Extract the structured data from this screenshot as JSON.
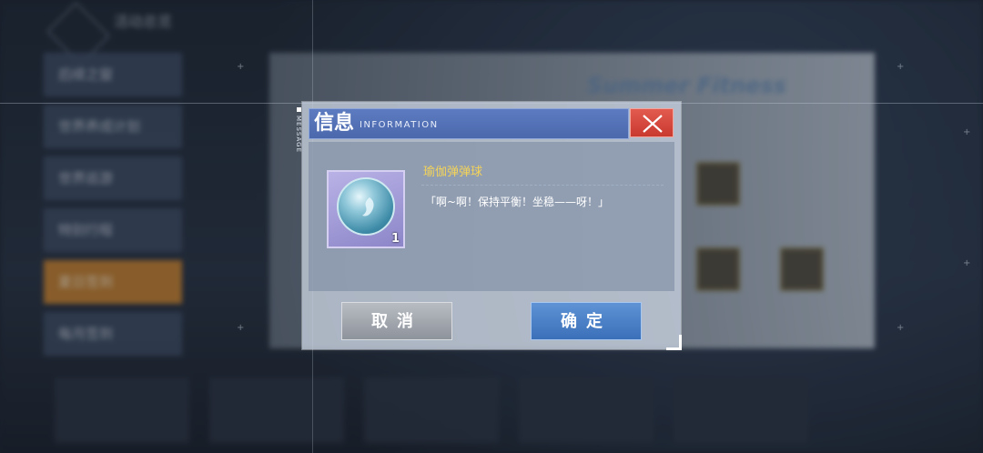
{
  "background": {
    "title": "活动总览",
    "menu": [
      "后续之窗",
      "世界养成计划",
      "世界巡游",
      "特别行程",
      "夏日签到",
      "每月签到"
    ],
    "banner_title": "Summer Fitness"
  },
  "dialog": {
    "title": "信息",
    "title_en": "INFORMATION",
    "side_tag": "MESSAGE",
    "item": {
      "name": "瑜伽弹弹球",
      "count": "1",
      "description": "「啊~啊！保持平衡！坐稳——呀！」",
      "icon": "yoga-ball-icon"
    },
    "cancel_label": "取消",
    "confirm_label": "确定"
  },
  "colors": {
    "header": "#4b68ad",
    "close": "#c9392f",
    "item_name": "#f3d35a",
    "confirm": "#3b6fb8",
    "cancel": "#8e949c"
  }
}
